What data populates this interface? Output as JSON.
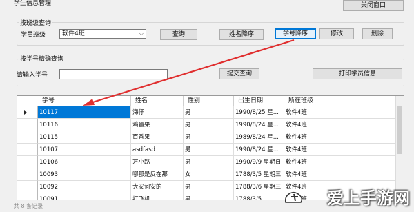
{
  "window": {
    "title": "学生信息管理",
    "close_label": "关闭窗口"
  },
  "class_group": {
    "title": "按班级查询",
    "class_label": "学员班级",
    "class_value": "软件4班",
    "query": "查询",
    "name_desc": "姓名降序",
    "id_desc": "学号降序",
    "modify": "修改",
    "delete": "删除"
  },
  "id_group": {
    "title": "按学号精确查询",
    "id_label": "请输入学号",
    "id_value": "",
    "submit": "提交查询",
    "print": "打印学员信息"
  },
  "table": {
    "columns": [
      "学号",
      "姓名",
      "性别",
      "出生日期",
      "所在班级"
    ],
    "rows": [
      [
        "10117",
        "海仔",
        "男",
        "1990/8/25 星...",
        "软件4班"
      ],
      [
        "10116",
        "鸡蛋果",
        "男",
        "1990/8/24 星...",
        "软件4班"
      ],
      [
        "10115",
        "百香果",
        "男",
        "1989/8/24 星...",
        "软件4班"
      ],
      [
        "10107",
        "asdfasd",
        "男",
        "1990/8/24 星...",
        "软件4班"
      ],
      [
        "10106",
        "万小路",
        "男",
        "1990/9/9 星期日",
        "软件4班"
      ],
      [
        "10093",
        "哪都是反在那",
        "女",
        "1788/3/5 星期三",
        "软件4班"
      ],
      [
        "10092",
        "大安诃安的",
        "男",
        "1788/3/6 星期三",
        "软件4班"
      ],
      [
        "10091",
        "打飞机",
        "男",
        "1788/3/5 ...",
        "软件4班"
      ]
    ]
  },
  "watermark": {
    "text": "爱上手游网"
  },
  "status": {
    "text": "共 8 条记录"
  },
  "colors": {
    "accent": "#0078d7",
    "arrow": "#e03030"
  },
  "icons": {
    "row_pointer": "row-pointer-icon",
    "dropdown": "chevron-down-icon"
  }
}
